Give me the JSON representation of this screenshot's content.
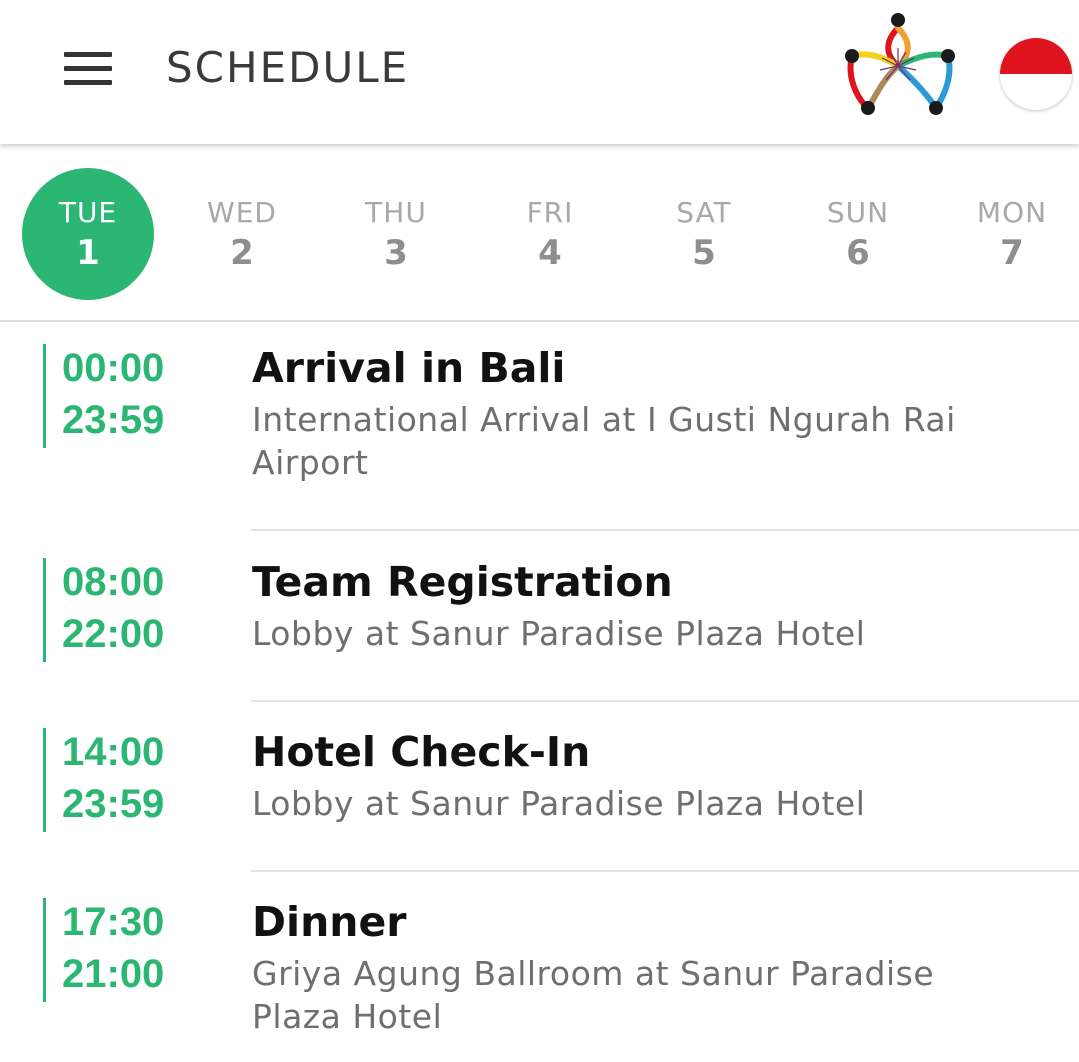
{
  "header": {
    "title": "SCHEDULE",
    "menu_icon": "hamburger-menu-icon",
    "logo_icon": "flower-logo-icon",
    "language_icon": "indonesia-flag-icon"
  },
  "colors": {
    "accent": "#2bb673",
    "flag_red": "#e0141e"
  },
  "days": [
    {
      "name": "TUE",
      "num": "1",
      "selected": true
    },
    {
      "name": "WED",
      "num": "2",
      "selected": false
    },
    {
      "name": "THU",
      "num": "3",
      "selected": false
    },
    {
      "name": "FRI",
      "num": "4",
      "selected": false
    },
    {
      "name": "SAT",
      "num": "5",
      "selected": false
    },
    {
      "name": "SUN",
      "num": "6",
      "selected": false
    },
    {
      "name": "MON",
      "num": "7",
      "selected": false
    }
  ],
  "events": [
    {
      "start": "00:00",
      "end": "23:59",
      "title": "Arrival in Bali",
      "location_line1": "International Arrival at I Gusti Ngurah Rai",
      "location_line2": "Airport"
    },
    {
      "start": "08:00",
      "end": "22:00",
      "title": "Team Registration",
      "location_line1": "Lobby at Sanur Paradise Plaza Hotel",
      "location_line2": ""
    },
    {
      "start": "14:00",
      "end": "23:59",
      "title": "Hotel Check-In",
      "location_line1": "Lobby at Sanur Paradise Plaza Hotel",
      "location_line2": ""
    },
    {
      "start": "17:30",
      "end": "21:00",
      "title": "Dinner",
      "location_line1": "Griya Agung Ballroom at Sanur Paradise",
      "location_line2": "Plaza Hotel"
    }
  ]
}
